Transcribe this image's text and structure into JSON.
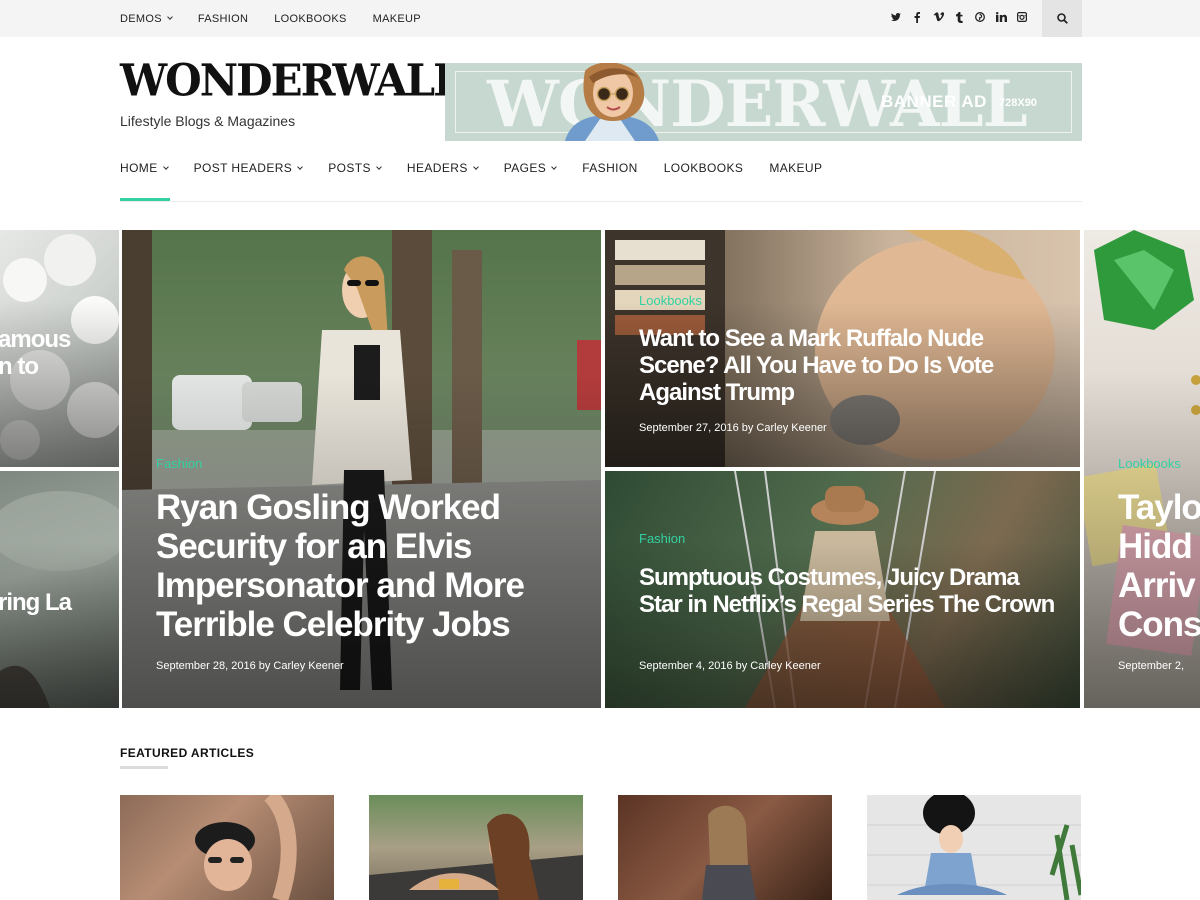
{
  "topbar": {
    "nav": [
      {
        "label": "DEMOS",
        "dropdown": true
      },
      {
        "label": "FASHION",
        "dropdown": false
      },
      {
        "label": "LOOKBOOKS",
        "dropdown": false
      },
      {
        "label": "MAKEUP",
        "dropdown": false
      }
    ],
    "social": [
      {
        "icon": "twitter-icon",
        "glyph": "𝕥"
      },
      {
        "icon": "facebook-icon",
        "glyph": "f"
      },
      {
        "icon": "vimeo-icon",
        "glyph": "v"
      },
      {
        "icon": "tumblr-icon",
        "glyph": "t"
      },
      {
        "icon": "pinterest-icon",
        "glyph": "℗"
      },
      {
        "icon": "linkedin-icon",
        "glyph": "in"
      },
      {
        "icon": "instagram-icon",
        "glyph": "◙"
      }
    ],
    "search_icon": "search-icon"
  },
  "header": {
    "logo": "WONDERWALL",
    "tagline": "Lifestyle Blogs & Magazines",
    "banner": {
      "brand": "WONDERWALL",
      "label": "BANNER AD",
      "size": "728X90"
    }
  },
  "mainnav": [
    {
      "label": "HOME",
      "dropdown": true,
      "active": true
    },
    {
      "label": "POST HEADERS",
      "dropdown": true
    },
    {
      "label": "POSTS",
      "dropdown": true
    },
    {
      "label": "HEADERS",
      "dropdown": true
    },
    {
      "label": "PAGES",
      "dropdown": true
    },
    {
      "label": "FASHION",
      "dropdown": false
    },
    {
      "label": "LOOKBOOKS",
      "dropdown": false
    },
    {
      "label": "MAKEUP",
      "dropdown": false
    }
  ],
  "slider": {
    "left_partial_top": {
      "title": "amous\nn to"
    },
    "left_partial_bottom": {
      "title": "ring La"
    },
    "main": {
      "category": "Fashion",
      "title": "Ryan Gosling Worked Security for an Elvis Impersonator and More Terrible Celebrity Jobs",
      "meta": "September 28, 2016 by Carley Keener"
    },
    "top_right": {
      "category": "Lookbooks",
      "title": "Want to See a Mark Ruffalo Nude Scene? All You Have to Do Is Vote Against Trump",
      "meta": "September 27, 2016 by Carley Keener"
    },
    "bottom_right": {
      "category": "Fashion",
      "title": "Sumptuous Costumes, Juicy Drama Star in Netflix’s Regal Series The Crown",
      "meta": "September 4, 2016 by Carley Keener"
    },
    "right_partial": {
      "category": "Lookbooks",
      "title": "Taylo\nHidd\nArriv\nCons",
      "meta": "September 2,"
    }
  },
  "featured": {
    "heading": "FEATURED ARTICLES"
  },
  "colors": {
    "accent": "#33d1a2",
    "topbar": "#f4f4f4",
    "banner": "#c6d8cf"
  }
}
